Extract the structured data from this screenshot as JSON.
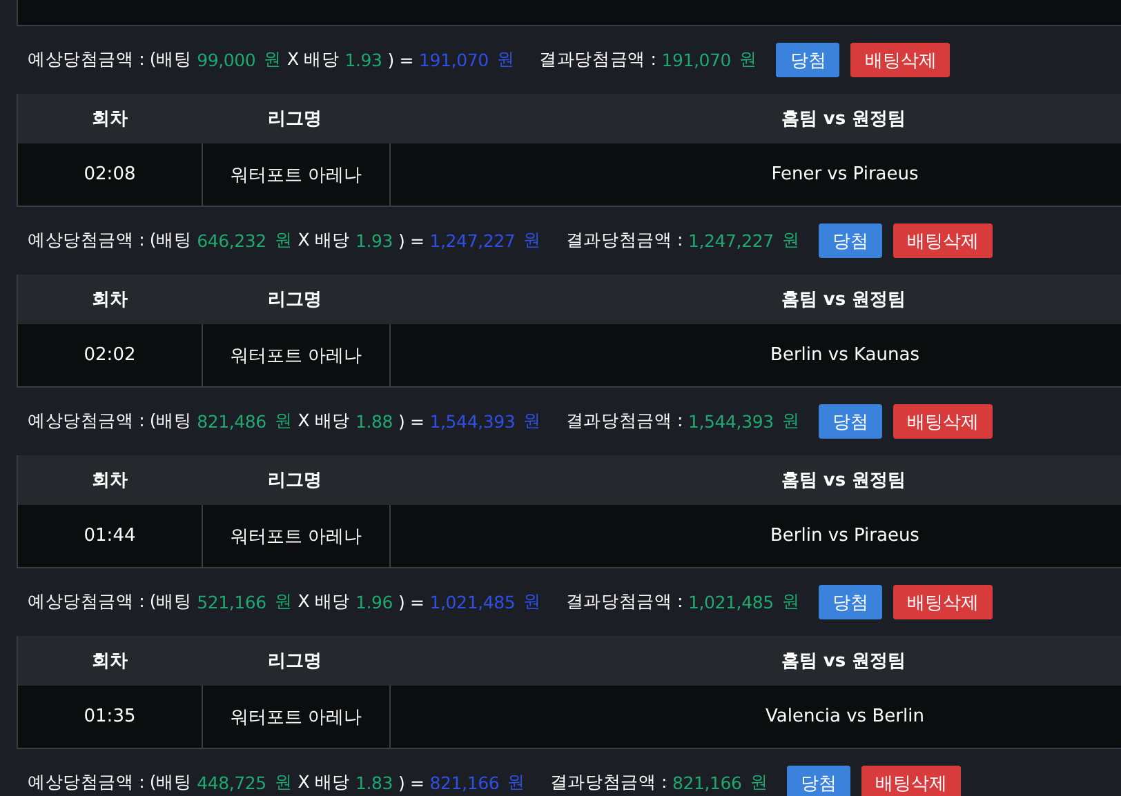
{
  "blocks": [
    {
      "summary": {
        "label": "예상당첨금액 : (배팅",
        "bet": "99,000",
        "bet_unit": "원",
        "odds_label": "X 배당",
        "odds": "1.93",
        "close": ") =",
        "expected": "191,070",
        "expected_unit": "원",
        "result_label": "결과당첨금액 :",
        "result": "191,070",
        "result_unit": "원",
        "buttons": [
          {
            "label": "당첨",
            "kind": "win"
          },
          {
            "label": "배팅삭제",
            "kind": "delete"
          }
        ]
      }
    },
    {
      "columns": [
        "회차",
        "리그명",
        "홈팀 vs 원정팀"
      ],
      "row": [
        "02:08",
        "워터포트 아레나",
        "Fener vs Piraeus"
      ],
      "summary": {
        "label": "예상당첨금액 : (배팅",
        "bet": "646,232",
        "bet_unit": "원",
        "odds_label": "X 배당",
        "odds": "1.93",
        "close": ") =",
        "expected": "1,247,227",
        "expected_unit": "원",
        "result_label": "결과당첨금액 :",
        "result": "1,247,227",
        "result_unit": "원",
        "buttons": [
          {
            "label": "당첨",
            "kind": "win"
          },
          {
            "label": "배팅삭제",
            "kind": "delete"
          }
        ]
      }
    },
    {
      "columns": [
        "회차",
        "리그명",
        "홈팀 vs 원정팀"
      ],
      "row": [
        "02:02",
        "워터포트 아레나",
        "Berlin vs Kaunas"
      ],
      "summary": {
        "label": "예상당첨금액 : (배팅",
        "bet": "821,486",
        "bet_unit": "원",
        "odds_label": "X 배당",
        "odds": "1.88",
        "close": ") =",
        "expected": "1,544,393",
        "expected_unit": "원",
        "result_label": "결과당첨금액 :",
        "result": "1,544,393",
        "result_unit": "원",
        "buttons": [
          {
            "label": "당첨",
            "kind": "win"
          },
          {
            "label": "배팅삭제",
            "kind": "delete"
          }
        ]
      }
    },
    {
      "columns": [
        "회차",
        "리그명",
        "홈팀 vs 원정팀"
      ],
      "row": [
        "01:44",
        "워터포트 아레나",
        "Berlin vs Piraeus"
      ],
      "summary": {
        "label": "예상당첨금액 : (배팅",
        "bet": "521,166",
        "bet_unit": "원",
        "odds_label": "X 배당",
        "odds": "1.96",
        "close": ") =",
        "expected": "1,021,485",
        "expected_unit": "원",
        "result_label": "결과당첨금액 :",
        "result": "1,021,485",
        "result_unit": "원",
        "buttons": [
          {
            "label": "당첨",
            "kind": "win"
          },
          {
            "label": "배팅삭제",
            "kind": "delete"
          }
        ]
      }
    },
    {
      "columns": [
        "회차",
        "리그명",
        "홈팀 vs 원정팀"
      ],
      "row": [
        "01:35",
        "워터포트 아레나",
        "Valencia vs Berlin"
      ],
      "summary": {
        "label": "예상당첨금액 : (배팅",
        "bet": "448,725",
        "bet_unit": "원",
        "odds_label": "X 배당",
        "odds": "1.83",
        "close": ") =",
        "expected": "821,166",
        "expected_unit": "원",
        "result_label": "결과당첨금액 :",
        "result": "821,166",
        "result_unit": "원",
        "buttons": [
          {
            "label": "당첨",
            "kind": "win"
          },
          {
            "label": "배팅삭제",
            "kind": "delete"
          }
        ]
      }
    }
  ]
}
